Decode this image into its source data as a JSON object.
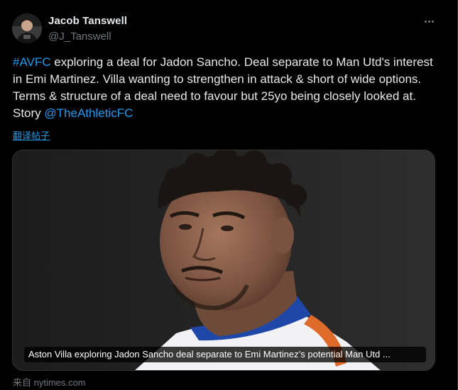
{
  "author": {
    "name": "Jacob Tanswell",
    "handle": "@J_Tanswell",
    "avatar_icon": "avatar-photo"
  },
  "more_icon": "more-options-icon",
  "tweet": {
    "hashtag": "#AVFC",
    "text_after_hashtag": " exploring a deal for Jadon Sancho. Deal separate to Man Utd's interest in Emi Martinez. Villa wanting to strengthen in attack & short of wide options. Terms & structure of a deal need to favour but 25yo being closely looked at. Story ",
    "mention": "@TheAthleticFC",
    "translate_label": "翻译帖子"
  },
  "card": {
    "image_icon": "player-photo",
    "caption": "Aston Villa exploring Jadon Sancho deal separate to Emi Martinez’s potential Man Utd ...",
    "source": "来自 nytimes.com"
  },
  "colors": {
    "background": "#000000",
    "text": "#e7e9ea",
    "secondary": "#71767b",
    "link": "#1d9bf0"
  }
}
